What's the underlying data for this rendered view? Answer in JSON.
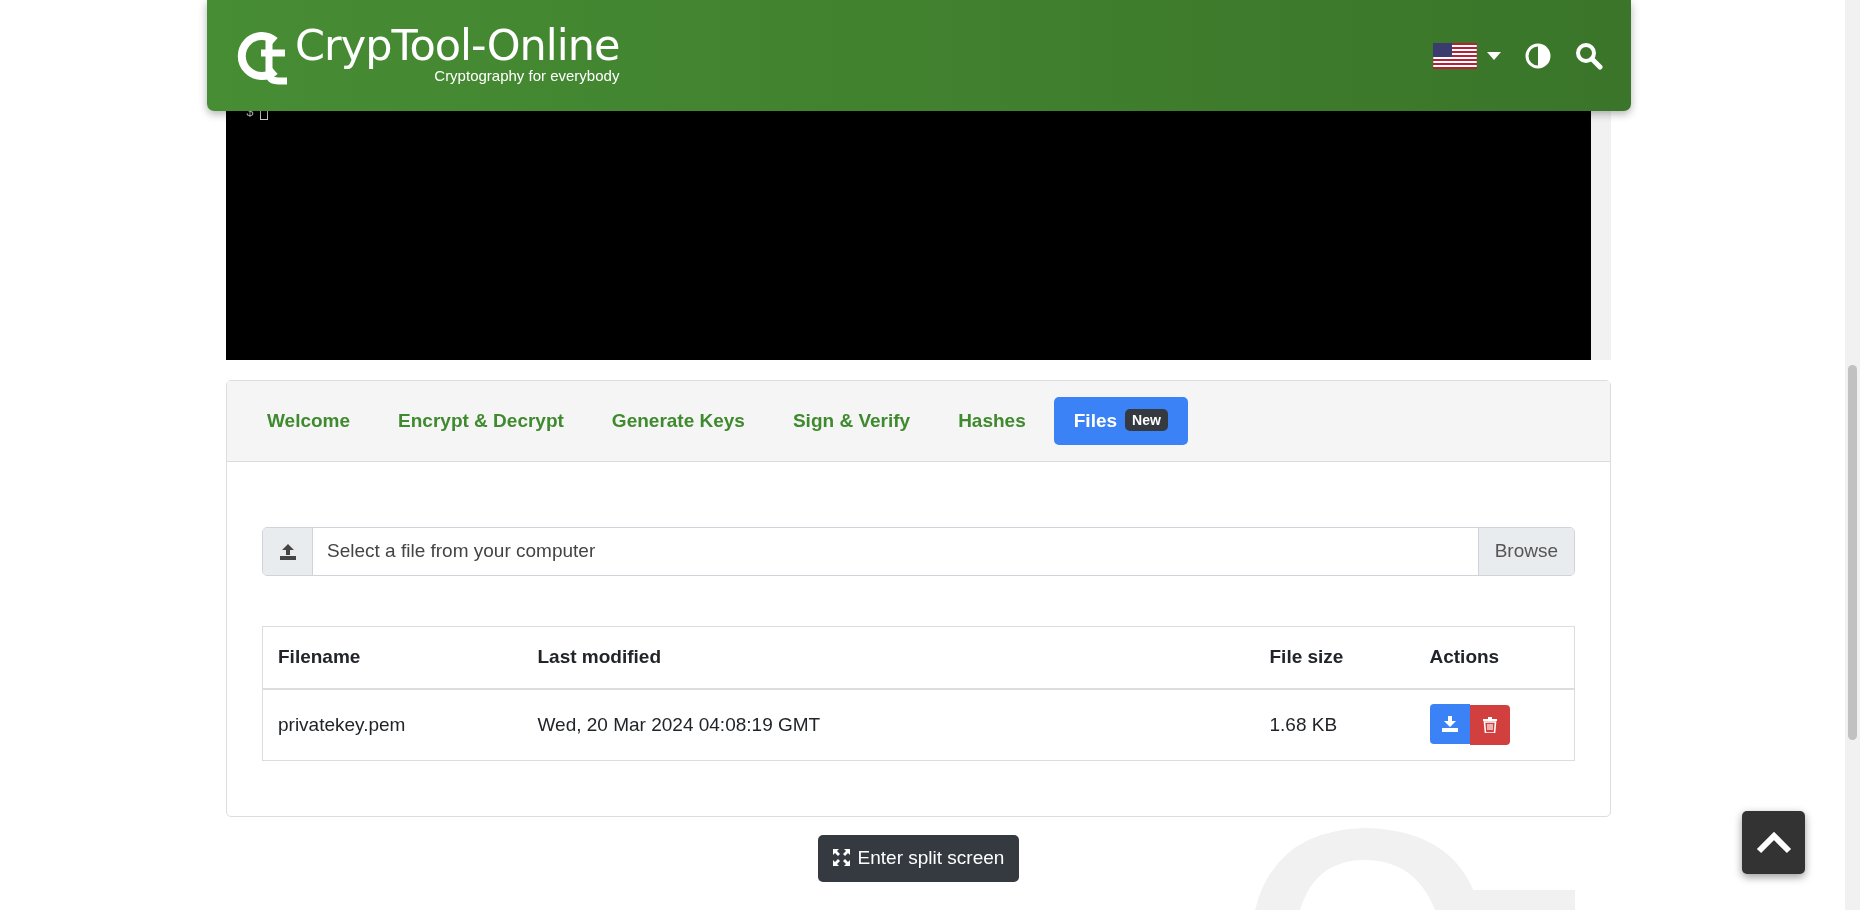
{
  "header": {
    "title": "CrypTool-Online",
    "subtitle": "Cryptography for everybody"
  },
  "terminal": {
    "prompt": "$"
  },
  "tabs": [
    {
      "label": "Welcome",
      "selected": false
    },
    {
      "label": "Encrypt & Decrypt",
      "selected": false
    },
    {
      "label": "Generate Keys",
      "selected": false
    },
    {
      "label": "Sign & Verify",
      "selected": false
    },
    {
      "label": "Hashes",
      "selected": false
    },
    {
      "label": "Files",
      "selected": true,
      "badge": "New"
    }
  ],
  "file_input": {
    "placeholder": "Select a file from your computer",
    "button": "Browse"
  },
  "table": {
    "columns": [
      "Filename",
      "Last modified",
      "File size",
      "Actions"
    ],
    "rows": [
      {
        "filename": "privatekey.pem",
        "modified": "Wed, 20 Mar 2024 04:08:19 GMT",
        "size": "1.68 KB"
      }
    ]
  },
  "split_button": "Enter split screen"
}
